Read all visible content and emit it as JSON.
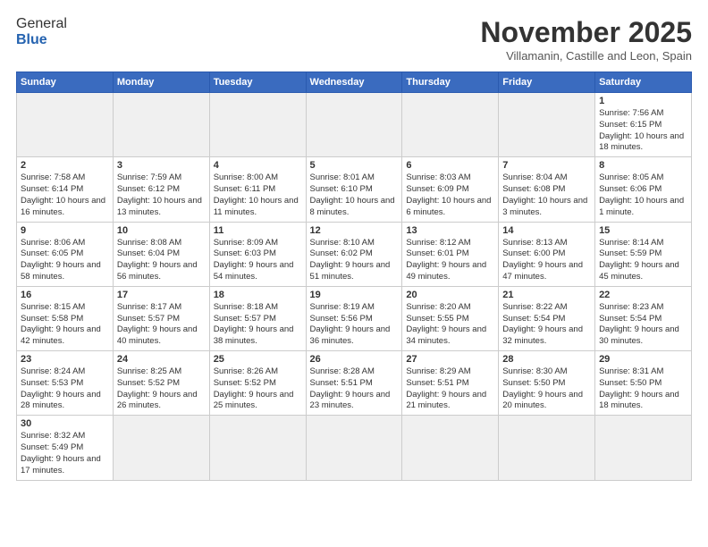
{
  "header": {
    "logo_general": "General",
    "logo_blue": "Blue",
    "month_title": "November 2025",
    "subtitle": "Villamanin, Castille and Leon, Spain"
  },
  "days_of_week": [
    "Sunday",
    "Monday",
    "Tuesday",
    "Wednesday",
    "Thursday",
    "Friday",
    "Saturday"
  ],
  "weeks": [
    [
      {
        "day": "",
        "info": ""
      },
      {
        "day": "",
        "info": ""
      },
      {
        "day": "",
        "info": ""
      },
      {
        "day": "",
        "info": ""
      },
      {
        "day": "",
        "info": ""
      },
      {
        "day": "",
        "info": ""
      },
      {
        "day": "1",
        "info": "Sunrise: 7:56 AM\nSunset: 6:15 PM\nDaylight: 10 hours and 18 minutes."
      }
    ],
    [
      {
        "day": "2",
        "info": "Sunrise: 7:58 AM\nSunset: 6:14 PM\nDaylight: 10 hours and 16 minutes."
      },
      {
        "day": "3",
        "info": "Sunrise: 7:59 AM\nSunset: 6:12 PM\nDaylight: 10 hours and 13 minutes."
      },
      {
        "day": "4",
        "info": "Sunrise: 8:00 AM\nSunset: 6:11 PM\nDaylight: 10 hours and 11 minutes."
      },
      {
        "day": "5",
        "info": "Sunrise: 8:01 AM\nSunset: 6:10 PM\nDaylight: 10 hours and 8 minutes."
      },
      {
        "day": "6",
        "info": "Sunrise: 8:03 AM\nSunset: 6:09 PM\nDaylight: 10 hours and 6 minutes."
      },
      {
        "day": "7",
        "info": "Sunrise: 8:04 AM\nSunset: 6:08 PM\nDaylight: 10 hours and 3 minutes."
      },
      {
        "day": "8",
        "info": "Sunrise: 8:05 AM\nSunset: 6:06 PM\nDaylight: 10 hours and 1 minute."
      }
    ],
    [
      {
        "day": "9",
        "info": "Sunrise: 8:06 AM\nSunset: 6:05 PM\nDaylight: 9 hours and 58 minutes."
      },
      {
        "day": "10",
        "info": "Sunrise: 8:08 AM\nSunset: 6:04 PM\nDaylight: 9 hours and 56 minutes."
      },
      {
        "day": "11",
        "info": "Sunrise: 8:09 AM\nSunset: 6:03 PM\nDaylight: 9 hours and 54 minutes."
      },
      {
        "day": "12",
        "info": "Sunrise: 8:10 AM\nSunset: 6:02 PM\nDaylight: 9 hours and 51 minutes."
      },
      {
        "day": "13",
        "info": "Sunrise: 8:12 AM\nSunset: 6:01 PM\nDaylight: 9 hours and 49 minutes."
      },
      {
        "day": "14",
        "info": "Sunrise: 8:13 AM\nSunset: 6:00 PM\nDaylight: 9 hours and 47 minutes."
      },
      {
        "day": "15",
        "info": "Sunrise: 8:14 AM\nSunset: 5:59 PM\nDaylight: 9 hours and 45 minutes."
      }
    ],
    [
      {
        "day": "16",
        "info": "Sunrise: 8:15 AM\nSunset: 5:58 PM\nDaylight: 9 hours and 42 minutes."
      },
      {
        "day": "17",
        "info": "Sunrise: 8:17 AM\nSunset: 5:57 PM\nDaylight: 9 hours and 40 minutes."
      },
      {
        "day": "18",
        "info": "Sunrise: 8:18 AM\nSunset: 5:57 PM\nDaylight: 9 hours and 38 minutes."
      },
      {
        "day": "19",
        "info": "Sunrise: 8:19 AM\nSunset: 5:56 PM\nDaylight: 9 hours and 36 minutes."
      },
      {
        "day": "20",
        "info": "Sunrise: 8:20 AM\nSunset: 5:55 PM\nDaylight: 9 hours and 34 minutes."
      },
      {
        "day": "21",
        "info": "Sunrise: 8:22 AM\nSunset: 5:54 PM\nDaylight: 9 hours and 32 minutes."
      },
      {
        "day": "22",
        "info": "Sunrise: 8:23 AM\nSunset: 5:54 PM\nDaylight: 9 hours and 30 minutes."
      }
    ],
    [
      {
        "day": "23",
        "info": "Sunrise: 8:24 AM\nSunset: 5:53 PM\nDaylight: 9 hours and 28 minutes."
      },
      {
        "day": "24",
        "info": "Sunrise: 8:25 AM\nSunset: 5:52 PM\nDaylight: 9 hours and 26 minutes."
      },
      {
        "day": "25",
        "info": "Sunrise: 8:26 AM\nSunset: 5:52 PM\nDaylight: 9 hours and 25 minutes."
      },
      {
        "day": "26",
        "info": "Sunrise: 8:28 AM\nSunset: 5:51 PM\nDaylight: 9 hours and 23 minutes."
      },
      {
        "day": "27",
        "info": "Sunrise: 8:29 AM\nSunset: 5:51 PM\nDaylight: 9 hours and 21 minutes."
      },
      {
        "day": "28",
        "info": "Sunrise: 8:30 AM\nSunset: 5:50 PM\nDaylight: 9 hours and 20 minutes."
      },
      {
        "day": "29",
        "info": "Sunrise: 8:31 AM\nSunset: 5:50 PM\nDaylight: 9 hours and 18 minutes."
      }
    ],
    [
      {
        "day": "30",
        "info": "Sunrise: 8:32 AM\nSunset: 5:49 PM\nDaylight: 9 hours and 17 minutes."
      },
      {
        "day": "",
        "info": ""
      },
      {
        "day": "",
        "info": ""
      },
      {
        "day": "",
        "info": ""
      },
      {
        "day": "",
        "info": ""
      },
      {
        "day": "",
        "info": ""
      },
      {
        "day": "",
        "info": ""
      }
    ]
  ]
}
